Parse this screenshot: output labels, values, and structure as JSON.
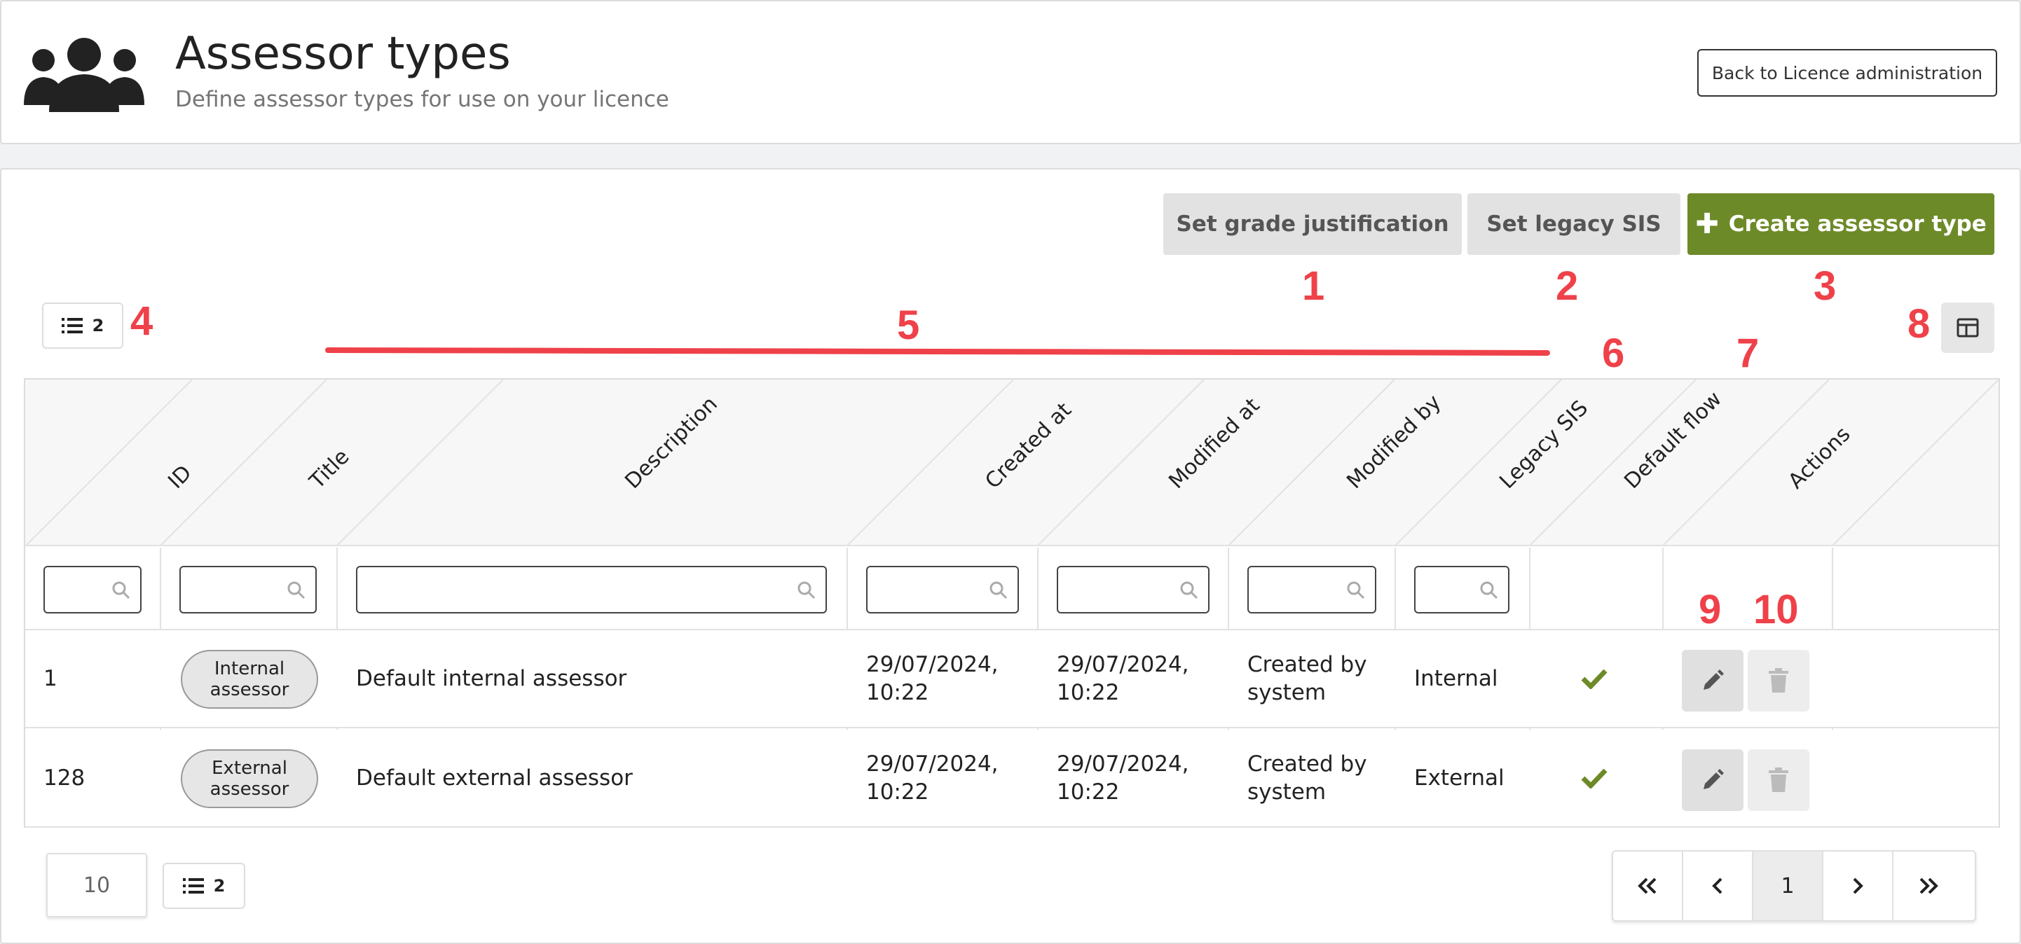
{
  "header": {
    "title": "Assessor types",
    "subtitle": "Define assessor types for use on your licence",
    "back_label": "Back to Licence administration",
    "icon": "users-group-icon"
  },
  "toolbar": {
    "grade_justification_label": "Set grade justification",
    "legacy_sis_label": "Set legacy SIS",
    "create_label": "Create assessor type"
  },
  "list_toggle": {
    "count": "2"
  },
  "annotations": [
    "1",
    "2",
    "3",
    "4",
    "5",
    "6",
    "7",
    "8",
    "9",
    "10"
  ],
  "table": {
    "columns": [
      "ID",
      "Title",
      "Description",
      "Created at",
      "Modified at",
      "Modified by",
      "Legacy SIS",
      "Default flow",
      "Actions"
    ],
    "rows": [
      {
        "id": "1",
        "title_line1": "Internal",
        "title_line2": "assessor",
        "description": "Default internal assessor",
        "created_line1": "29/07/2024,",
        "created_line2": "10:22",
        "modified_line1": "29/07/2024,",
        "modified_line2": "10:22",
        "modified_by_line1": "Created by",
        "modified_by_line2": "system",
        "legacy_sis": "Internal",
        "default_flow": true
      },
      {
        "id": "128",
        "title_line1": "External",
        "title_line2": "assessor",
        "description": "Default external assessor",
        "created_line1": "29/07/2024,",
        "created_line2": "10:22",
        "modified_line1": "29/07/2024,",
        "modified_line2": "10:22",
        "modified_by_line1": "Created by",
        "modified_by_line2": "system",
        "legacy_sis": "External",
        "default_flow": true
      }
    ]
  },
  "footer": {
    "per_page": "10",
    "list_count": "2",
    "current_page": "1"
  },
  "colors": {
    "primary_green": "#6d8a28",
    "check_green": "#6d8a28",
    "annotation_red": "#ef4149"
  }
}
